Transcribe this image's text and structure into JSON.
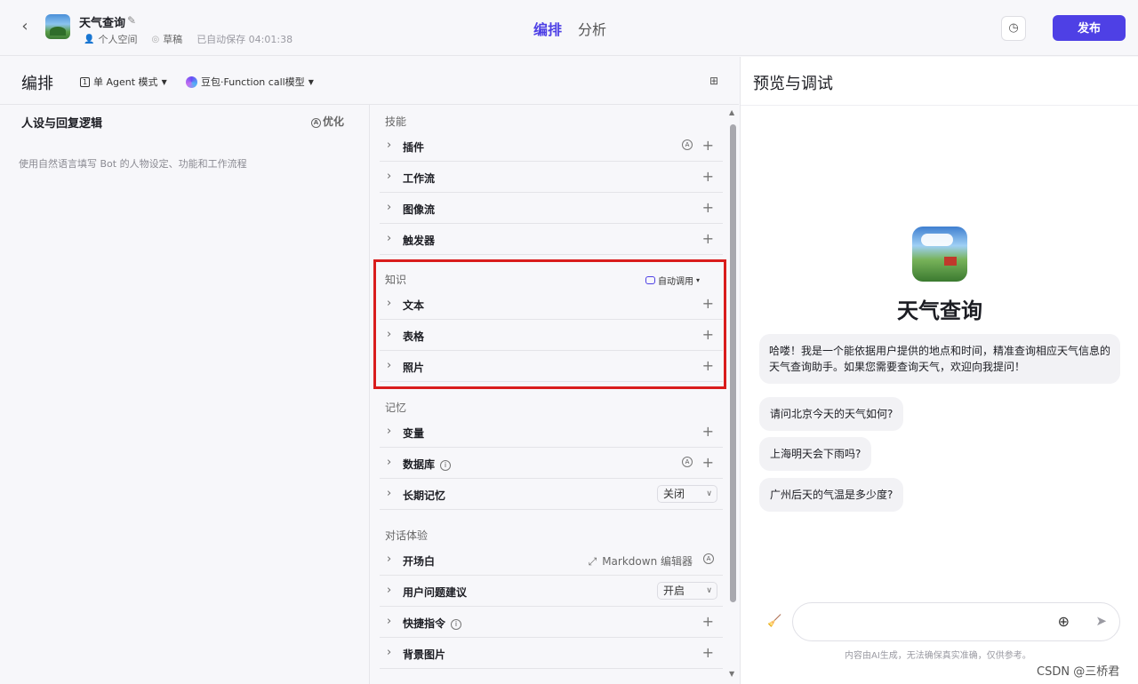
{
  "header": {
    "back_icon": "chevron-left-icon",
    "bot_name": "天气查询",
    "space": "个人空间",
    "status": "草稿",
    "autosave": "已自动保存 04:01:38",
    "tabs": [
      "编排",
      "分析"
    ],
    "publish_label": "发布"
  },
  "toolbar": {
    "title": "编排",
    "mode": "单 Agent 模式",
    "model": "豆包·Function call模型"
  },
  "persona": {
    "title": "人设与回复逻辑",
    "optimize_label": "优化",
    "placeholder": "使用自然语言填写 Bot 的人物设定、功能和工作流程"
  },
  "skills": {
    "label": "技能",
    "items": [
      "插件",
      "工作流",
      "图像流",
      "触发器"
    ]
  },
  "knowledge": {
    "label": "知识",
    "auto_invoke": "自动调用",
    "items": [
      "文本",
      "表格",
      "照片"
    ]
  },
  "memory": {
    "label": "记忆",
    "items": [
      "变量",
      "数据库",
      "长期记忆"
    ],
    "long_term_value": "关闭"
  },
  "dialog": {
    "label": "对话体验",
    "items": [
      "开场白",
      "用户问题建议",
      "快捷指令",
      "背景图片"
    ],
    "markdown_editor": "Markdown 编辑器",
    "suggest_value": "开启"
  },
  "preview": {
    "title": "预览与调试",
    "bot_name": "天气查询",
    "intro": "哈喽！我是一个能依据用户提供的地点和时间，精准查询相应天气信息的天气查询助手。如果您需要查询天气，欢迎向我提问！",
    "suggestions": [
      "请问北京今天的天气如何?",
      "上海明天会下雨吗?",
      "广州后天的气温是多少度?"
    ],
    "disclaimer": "内容由AI生成，无法确保真实准确，仅供参考。"
  },
  "watermark": "CSDN @三桥君",
  "colors": {
    "accent": "#4e40e5",
    "highlight": "#d91c1c"
  }
}
